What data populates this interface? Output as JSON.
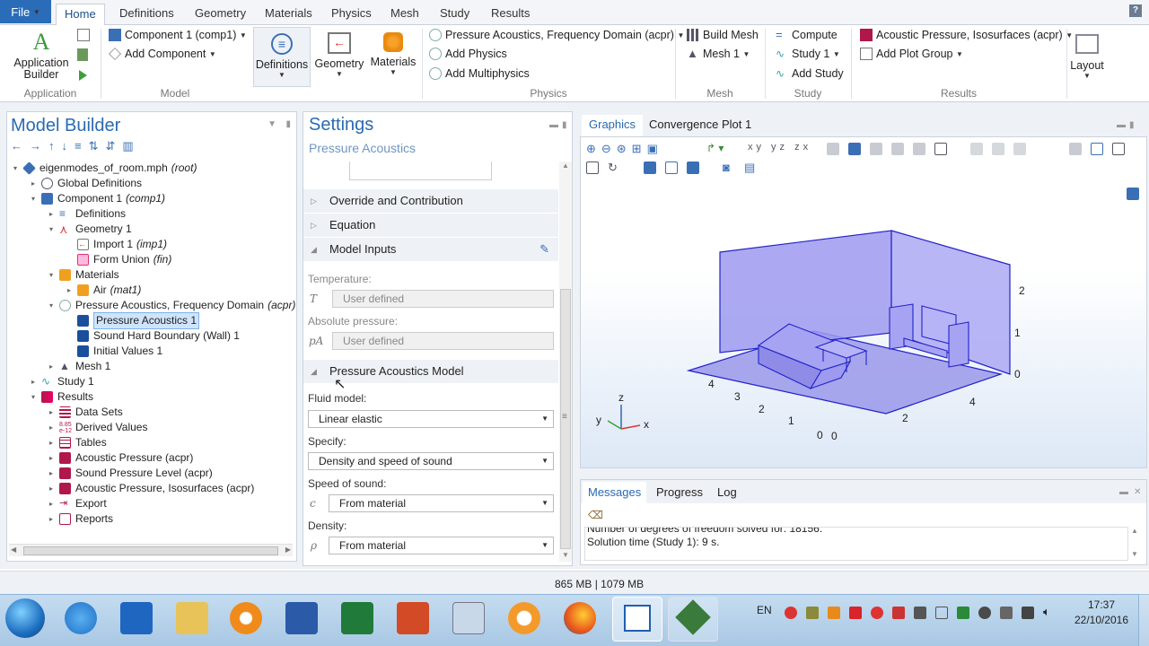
{
  "ribbon": {
    "file_label": "File",
    "tabs": [
      "Home",
      "Definitions",
      "Geometry",
      "Materials",
      "Physics",
      "Mesh",
      "Study",
      "Results"
    ],
    "help": "?",
    "groups": {
      "application": "Application",
      "model": "Model",
      "physics": "Physics",
      "mesh": "Mesh",
      "study": "Study",
      "results": "Results"
    },
    "application_builder": "Application Builder",
    "component": "Component 1 (comp1)",
    "add_component": "Add Component",
    "definitions": "Definitions",
    "geometry": "Geometry",
    "materials": "Materials",
    "physics_interface": "Pressure Acoustics, Frequency Domain (acpr)",
    "add_physics": "Add Physics",
    "add_multiphysics": "Add Multiphysics",
    "build_mesh": "Build Mesh",
    "mesh1": "Mesh 1",
    "compute": "Compute",
    "study1": "Study 1",
    "add_study": "Add Study",
    "plot_group": "Acoustic Pressure, Isosurfaces (acpr)",
    "add_plot_group": "Add Plot Group",
    "layout": "Layout"
  },
  "model_builder": {
    "title": "Model Builder",
    "tree": [
      {
        "label": "eigenmodes_of_room.mph",
        "tag": "(root)"
      },
      {
        "label": "Global Definitions",
        "tag": ""
      },
      {
        "label": "Component 1",
        "tag": "(comp1)"
      },
      {
        "label": "Definitions",
        "tag": ""
      },
      {
        "label": "Geometry 1",
        "tag": ""
      },
      {
        "label": "Import 1",
        "tag": "(imp1)"
      },
      {
        "label": "Form Union",
        "tag": "(fin)"
      },
      {
        "label": "Materials",
        "tag": ""
      },
      {
        "label": "Air",
        "tag": "(mat1)"
      },
      {
        "label": "Pressure Acoustics, Frequency Domain",
        "tag": "(acpr)"
      },
      {
        "label": "Pressure Acoustics 1",
        "tag": ""
      },
      {
        "label": "Sound Hard Boundary (Wall) 1",
        "tag": ""
      },
      {
        "label": "Initial Values 1",
        "tag": ""
      },
      {
        "label": "Mesh 1",
        "tag": ""
      },
      {
        "label": "Study 1",
        "tag": ""
      },
      {
        "label": "Results",
        "tag": ""
      },
      {
        "label": "Data Sets",
        "tag": ""
      },
      {
        "label": "Derived Values",
        "tag": ""
      },
      {
        "label": "Tables",
        "tag": ""
      },
      {
        "label": "Acoustic Pressure (acpr)",
        "tag": ""
      },
      {
        "label": "Sound Pressure Level (acpr)",
        "tag": ""
      },
      {
        "label": "Acoustic Pressure, Isosurfaces (acpr)",
        "tag": ""
      },
      {
        "label": "Export",
        "tag": ""
      },
      {
        "label": "Reports",
        "tag": ""
      }
    ]
  },
  "settings": {
    "title": "Settings",
    "subtitle": "Pressure Acoustics",
    "sections": {
      "override": "Override and Contribution",
      "equation": "Equation",
      "model_inputs": "Model Inputs",
      "pa_model": "Pressure Acoustics Model"
    },
    "temperature_label": "Temperature:",
    "temperature_symbol": "T",
    "temperature_value": "User defined",
    "abs_pressure_label": "Absolute pressure:",
    "abs_pressure_symbol": "pA",
    "abs_pressure_value": "User defined",
    "fluid_model_label": "Fluid model:",
    "fluid_model_value": "Linear elastic",
    "specify_label": "Specify:",
    "specify_value": "Density and speed of sound",
    "speed_label": "Speed of sound:",
    "speed_symbol": "c",
    "speed_value": "From material",
    "density_label": "Density:",
    "density_symbol": "ρ",
    "density_value": "From material"
  },
  "graphics": {
    "tabs": [
      "Graphics",
      "Convergence Plot 1"
    ],
    "axis_labels": {
      "x": "x",
      "y": "y",
      "z": "z"
    },
    "ticks_z": [
      "2",
      "1",
      "0"
    ],
    "ticks_x": [
      "0",
      "2",
      "4"
    ],
    "ticks_y": [
      "4",
      "3",
      "2",
      "1",
      "0"
    ]
  },
  "messages": {
    "tabs": [
      "Messages",
      "Progress",
      "Log"
    ],
    "line1": "Number of degrees of freedom solved for: 18156.",
    "line2": "Solution time (Study 1): 9 s."
  },
  "status_bar": {
    "memory": "865 MB | 1079 MB"
  },
  "taskbar": {
    "language": "EN",
    "time": "17:37",
    "date": "22/10/2016"
  },
  "colors": {
    "accent": "#2a6ab0",
    "room_fill": "#8f8ce8",
    "room_edge": "#2222cc"
  }
}
